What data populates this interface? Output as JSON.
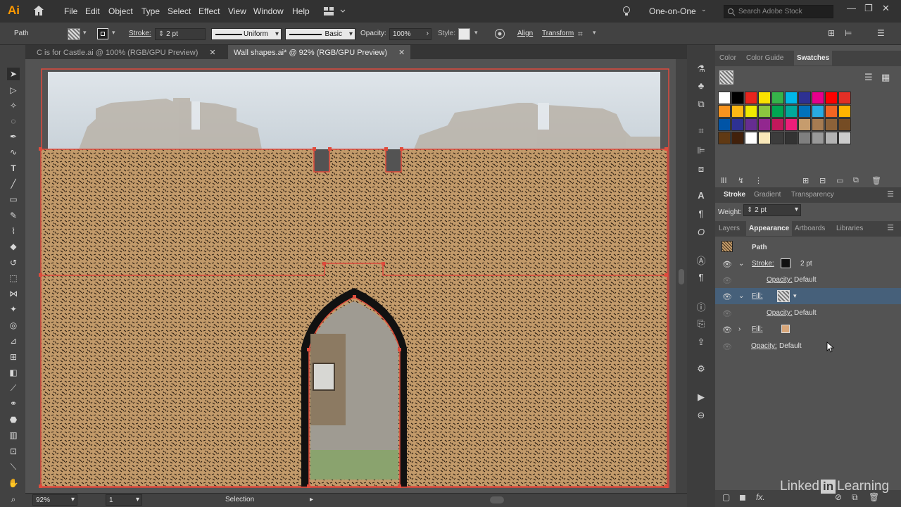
{
  "app": {
    "logo": "Ai"
  },
  "menu": [
    "File",
    "Edit",
    "Object",
    "Type",
    "Select",
    "Effect",
    "View",
    "Window",
    "Help"
  ],
  "workspace": {
    "label": "One-on-One",
    "search_placeholder": "Search Adobe Stock"
  },
  "control_bar": {
    "selection_type": "Path",
    "stroke_label": "Stroke:",
    "stroke_weight": "2 pt",
    "stroke_profile": "Uniform",
    "brush": "Basic",
    "opacity_label": "Opacity:",
    "opacity_value": "100%",
    "style_label": "Style:",
    "align": "Align",
    "transform": "Transform"
  },
  "tabs": [
    {
      "title": "C is for Castle.ai @ 100% (RGB/GPU Preview)",
      "active": false
    },
    {
      "title": "Wall shapes.ai* @ 92% (RGB/GPU Preview)",
      "active": true
    }
  ],
  "swatches_panel": {
    "tabs": [
      "Color",
      "Color Guide",
      "Swatches"
    ],
    "active": "Swatches",
    "colors": [
      [
        "#ffffff",
        "#000000",
        "#e8241d",
        "#fbe100",
        "#36b34a",
        "#00b8e8",
        "#2e3192",
        "#e6008c",
        "#ff0000",
        "#e22f26"
      ],
      [
        "#f7931e",
        "#fcb814",
        "#f0ea00",
        "#8cc63f",
        "#00a651",
        "#00a99d",
        "#0072bc",
        "#29abe2",
        "#f26522",
        "#ffb400"
      ],
      [
        "#0054a6",
        "#2e3192",
        "#662d91",
        "#92278f",
        "#c2185b",
        "#ed1e79",
        "#c69c6d",
        "#a67c52",
        "#8c6239",
        "#754c24"
      ],
      [
        "#603913",
        "#42210b",
        "#ffffff",
        "#f8e7b9",
        "#3c3c3c",
        "#333333",
        "#7f7f7f",
        "#999999",
        "#b3b3b3",
        "#cccccc"
      ]
    ]
  },
  "stroke_panel": {
    "tabs": [
      "Stroke",
      "Gradient",
      "Transparency"
    ],
    "weight_label": "Weight:",
    "weight_value": "2 pt"
  },
  "appearance_panel": {
    "tabs": [
      "Layers",
      "Appearance",
      "Artboards",
      "Libraries"
    ],
    "active": "Appearance",
    "object": "Path",
    "rows": [
      {
        "label": "Stroke:",
        "value": "2 pt"
      },
      {
        "label": "Opacity:",
        "value": "Default"
      },
      {
        "label": "Fill:",
        "value": ""
      },
      {
        "label": "Opacity:",
        "value": "Default"
      },
      {
        "label": "Fill:",
        "value": ""
      },
      {
        "label": "Opacity:",
        "value": "Default"
      }
    ]
  },
  "status": {
    "zoom": "92%",
    "artboard": "1",
    "tool": "Selection"
  },
  "watermark": {
    "left": "Linked",
    "in": "in",
    "right": "Learning"
  },
  "colors": {
    "accent": "#f7931e",
    "selection_red": "#e04b3c",
    "pattern_tan": "#c29a6a"
  }
}
